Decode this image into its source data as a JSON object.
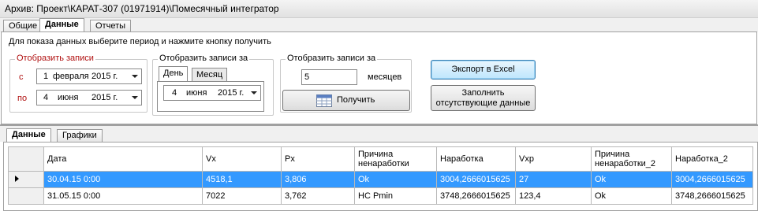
{
  "window": {
    "title": "Архив: Проект\\КАРАТ-307 (01971914)\\Помесячный интегратор"
  },
  "main_tabs": [
    "Общие",
    "Данные",
    "Отчеты"
  ],
  "hint": "Для показа данных выберите период и нажмите кнопку получить",
  "group_display": {
    "title": "Отобразить записи",
    "from_label": "с",
    "from_day": "1",
    "from_month": "февраля",
    "from_year": "2015 г.",
    "to_label": "по",
    "to_day": "4",
    "to_month": "июня",
    "to_year": "2015 г."
  },
  "group_display_for": {
    "title": "Отобразить записи за",
    "tabs": [
      "День",
      "Месяц"
    ],
    "day": "4",
    "month": "июня",
    "year": "2015 г."
  },
  "group_months": {
    "title": "Отобразить записи за",
    "value": "5",
    "unit": "месяцев"
  },
  "buttons": {
    "get": "Получить",
    "export": "Экспорт в Excel",
    "fill_line1": "Заполнить",
    "fill_line2": "отсутствующие данные"
  },
  "data_tabs": [
    "Данные",
    "Графики"
  ],
  "table": {
    "columns": [
      {
        "l1": "Дата",
        "l2": ""
      },
      {
        "l1": "Vx",
        "l2": ""
      },
      {
        "l1": "Px",
        "l2": ""
      },
      {
        "l1": "Причина",
        "l2": "ненаработки"
      },
      {
        "l1": "Наработка",
        "l2": ""
      },
      {
        "l1": "Vxp",
        "l2": ""
      },
      {
        "l1": "Причина",
        "l2": "ненаработки_2"
      },
      {
        "l1": "Наработка_2",
        "l2": ""
      }
    ],
    "rows": [
      [
        "30.04.15 0:00",
        "4518,1",
        "3,806",
        "Ok",
        "3004,2666015625",
        "27",
        "Ok",
        "3004,2666015625"
      ],
      [
        "31.05.15 0:00",
        "7022",
        "3,762",
        "HC Pmin",
        "3748,2666015625",
        "123,4",
        "Ok",
        "3748,2666015625"
      ]
    ],
    "selected_row": 0
  }
}
